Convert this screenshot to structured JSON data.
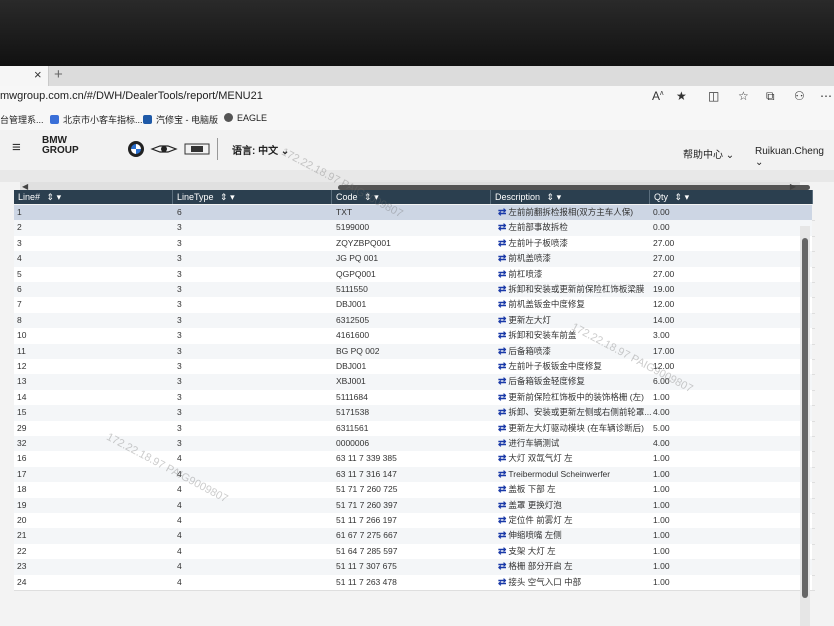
{
  "browser": {
    "tab_close": "×",
    "tab_new": "+",
    "url": "mwgroup.com.cn/#/DWH/DealerTools/report/MENU21",
    "bookmarks": [
      "台管理系...",
      "北京市小客车指标...",
      "汽修宝 - 电脑版",
      "EAGLE"
    ]
  },
  "header": {
    "menu_icon": "≡",
    "logo_line1": "BMW",
    "logo_line2": "GROUP",
    "language": "语言: 中文",
    "help": "帮助中心",
    "user": "Ruikuan.Cheng"
  },
  "watermark": "172.22.18.97 PAIG9009807",
  "grid": {
    "columns": [
      {
        "label": "Line#"
      },
      {
        "label": "LineType"
      },
      {
        "label": "Code"
      },
      {
        "label": "Description"
      },
      {
        "label": "Qty"
      }
    ],
    "rows": [
      {
        "line": "1",
        "type": "6",
        "code": "TXT",
        "desc": "左前前翻拆检报相(双方主车人保)",
        "qty": "0.00"
      },
      {
        "line": "2",
        "type": "3",
        "code": "5199000",
        "desc": "左前部事故拆检",
        "qty": "0.00"
      },
      {
        "line": "3",
        "type": "3",
        "code": "ZQYZBPQ001",
        "desc": "左前叶子板喷漆",
        "qty": "27.00"
      },
      {
        "line": "4",
        "type": "3",
        "code": "JG PQ 001",
        "desc": "前机盖喷漆",
        "qty": "27.00"
      },
      {
        "line": "5",
        "type": "3",
        "code": "QGPQ001",
        "desc": "前杠喷漆",
        "qty": "27.00"
      },
      {
        "line": "6",
        "type": "3",
        "code": "5111550",
        "desc": "拆卸和安装或更新前保险杠饰板梁膜",
        "qty": "19.00"
      },
      {
        "line": "7",
        "type": "3",
        "code": "DBJ001",
        "desc": "前机盖钣金中度修复",
        "qty": "12.00"
      },
      {
        "line": "8",
        "type": "3",
        "code": "6312505",
        "desc": "更新左大灯",
        "qty": "14.00"
      },
      {
        "line": "10",
        "type": "3",
        "code": "4161600",
        "desc": "拆卸和安装车前盖",
        "qty": "3.00"
      },
      {
        "line": "11",
        "type": "3",
        "code": "BG PQ 002",
        "desc": "后备箱喷漆",
        "qty": "17.00"
      },
      {
        "line": "12",
        "type": "3",
        "code": "DBJ001",
        "desc": "左前叶子板钣金中度修复",
        "qty": "12.00"
      },
      {
        "line": "13",
        "type": "3",
        "code": "XBJ001",
        "desc": "后备箱钣金轻度修复",
        "qty": "6.00"
      },
      {
        "line": "14",
        "type": "3",
        "code": "5111684",
        "desc": "更新前保险杠饰板中的装饰格栅 (左)",
        "qty": "1.00"
      },
      {
        "line": "15",
        "type": "3",
        "code": "5171538",
        "desc": "拆卸、安装或更新左侧或右侧前轮罩...",
        "qty": "4.00"
      },
      {
        "line": "29",
        "type": "3",
        "code": "6311561",
        "desc": "更新左大灯驱动模块 (在车辆诊断后)",
        "qty": "5.00"
      },
      {
        "line": "32",
        "type": "3",
        "code": "0000006",
        "desc": "进行车辆测试",
        "qty": "4.00"
      },
      {
        "line": "16",
        "type": "4",
        "code": "63 11 7 339 385",
        "desc": "大灯 双氙气灯 左",
        "qty": "1.00"
      },
      {
        "line": "17",
        "type": "4",
        "code": "63 11 7 316 147",
        "desc": "Treibermodul Scheinwerfer",
        "qty": "1.00"
      },
      {
        "line": "18",
        "type": "4",
        "code": "51 71 7 260 725",
        "desc": "盖板 下部 左",
        "qty": "1.00"
      },
      {
        "line": "19",
        "type": "4",
        "code": "51 71 7 260 397",
        "desc": "盖罩 更换灯泡",
        "qty": "1.00"
      },
      {
        "line": "20",
        "type": "4",
        "code": "51 11 7 266 197",
        "desc": "定位件 前雾灯 左",
        "qty": "1.00"
      },
      {
        "line": "21",
        "type": "4",
        "code": "61 67 7 275 667",
        "desc": "伸缩喷嘴 左侧",
        "qty": "1.00"
      },
      {
        "line": "22",
        "type": "4",
        "code": "51 64 7 285 597",
        "desc": "支架 大灯 左",
        "qty": "1.00"
      },
      {
        "line": "23",
        "type": "4",
        "code": "51 11 7 307 675",
        "desc": "格栅 部分开启 左",
        "qty": "1.00"
      },
      {
        "line": "24",
        "type": "4",
        "code": "51 11 7 263 478",
        "desc": "接头 空气入口 中部",
        "qty": "1.00"
      }
    ]
  }
}
